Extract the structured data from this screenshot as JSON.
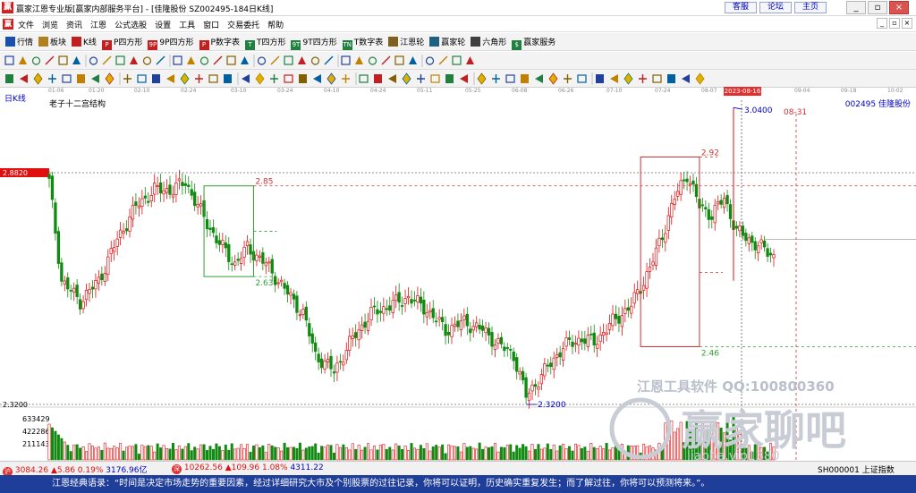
{
  "window": {
    "icon": "赢",
    "title": "赢家江恩专业版[赢家内部服务平台] - [佳隆股份  SZ002495-184日K线]",
    "links": [
      "客服",
      "论坛",
      "主页"
    ],
    "controls": [
      "_",
      "▫",
      "×"
    ]
  },
  "menu": {
    "icon": "赢",
    "items": [
      "文件",
      "浏览",
      "资讯",
      "江恩",
      "公式选股",
      "设置",
      "工具",
      "窗口",
      "交易委托",
      "帮助"
    ],
    "mdi": [
      "_",
      "▫",
      "×"
    ]
  },
  "toolbar1": {
    "items": [
      {
        "label": "行情",
        "icon": "grid-icon"
      },
      {
        "label": "板块",
        "icon": "blocks-icon"
      },
      {
        "label": "K线",
        "icon": "kline-icon"
      },
      {
        "label": "P四方形",
        "icon": "p-square-icon",
        "badge": "P"
      },
      {
        "label": "9P四方形",
        "icon": "9p-square-icon",
        "badge": "9P"
      },
      {
        "label": "P数字表",
        "icon": "p-table-icon",
        "badge": "P"
      },
      {
        "label": "T四方形",
        "icon": "t-square-icon",
        "badge": "T"
      },
      {
        "label": "9T四方形",
        "icon": "9t-square-icon",
        "badge": "9T"
      },
      {
        "label": "T数字表",
        "icon": "t-table-icon",
        "badge": "TN"
      },
      {
        "label": "江恩轮",
        "icon": "gann-wheel-icon"
      },
      {
        "label": "赢家轮",
        "icon": "winner-wheel-icon"
      },
      {
        "label": "六角形",
        "icon": "hexagon-icon"
      },
      {
        "label": "赢家服务",
        "icon": "service-icon",
        "badge": "$"
      }
    ]
  },
  "dates": [
    "01-06",
    "01-20",
    "02-10",
    "02-24",
    "03-10",
    "03-24",
    "04-10",
    "04-24",
    "05-11",
    "05-25",
    "06-08",
    "06-26",
    "07-10",
    "07-24",
    "08-07",
    "09-04",
    "09-18",
    "10-02"
  ],
  "selected_date": "2023-08-16",
  "chart": {
    "period_label": "日K线",
    "structure_label": "老子十二宫结构",
    "stock": "002495  佳隆股份",
    "price_high_label": "2.8820",
    "price_low_label": "2.3200",
    "peak_label": "3.0400",
    "low_point_label": "2.3200",
    "box1_top": "2.85",
    "box1_bottom": "2.63",
    "box2_top": "2.92",
    "box2_bottom": "2.46",
    "future_date": "08-31",
    "volume_labels": [
      "633429",
      "422286",
      "211143"
    ],
    "colors": {
      "up": "#e01010",
      "down": "#108a10",
      "grid": "#c8c8c8",
      "box1": "#30a030",
      "box2": "#d03030",
      "dash": "#d03030"
    }
  },
  "watermark": {
    "line1": "江恩工具软件  QQ:100800360",
    "main": "赢家聊吧",
    "sub": "liaoba.vip1380"
  },
  "statusbar": {
    "idx1_badge": "沪",
    "idx1": "3084.26",
    "idx1_change": "▲5.86 0.19%",
    "idx1_amount": "3176.96亿",
    "idx2_badge": "深",
    "idx2": "10262.56",
    "idx2_change": "▲109.96 1.08%",
    "idx2_amount": "4311.22",
    "right": "SH000001 上证指数"
  },
  "quote": "江恩经典语录：“时间是决定市场走势的重要因素，经过详细研究大市及个别股票的过往记录，你将可以证明，历史确实重复发生；而了解过往，你将可以预测将来。”。"
}
